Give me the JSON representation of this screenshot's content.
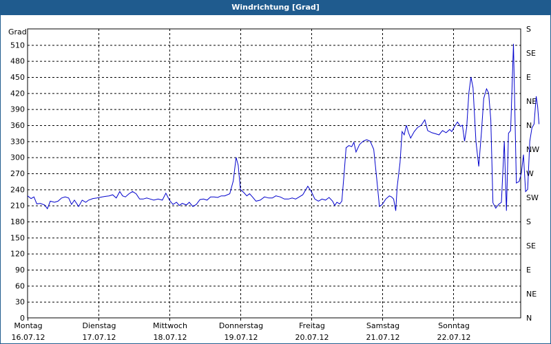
{
  "chart_data": {
    "type": "line",
    "title": "Windrichtung [Grad]",
    "ylabel": "Grad",
    "ylim": [
      0,
      540
    ],
    "y_ticks": [
      0,
      30,
      60,
      90,
      120,
      150,
      180,
      210,
      240,
      270,
      300,
      330,
      360,
      390,
      420,
      450,
      480,
      510
    ],
    "right_ticks": [
      {
        "value": 0,
        "label": "N"
      },
      {
        "value": 45,
        "label": "NE"
      },
      {
        "value": 90,
        "label": "E"
      },
      {
        "value": 135,
        "label": "SE"
      },
      {
        "value": 180,
        "label": "S"
      },
      {
        "value": 225,
        "label": "SW"
      },
      {
        "value": 270,
        "label": "W"
      },
      {
        "value": 315,
        "label": "NW"
      },
      {
        "value": 360,
        "label": "N"
      },
      {
        "value": 405,
        "label": "NE"
      },
      {
        "value": 450,
        "label": "E"
      },
      {
        "value": 495,
        "label": "SE"
      },
      {
        "value": 540,
        "label": "S"
      }
    ],
    "x_days": [
      {
        "day": "Montag",
        "date": "16.07.12"
      },
      {
        "day": "Dienstag",
        "date": "17.07.12"
      },
      {
        "day": "Mittwoch",
        "date": "18.07.12"
      },
      {
        "day": "Donnerstag",
        "date": "19.07.12"
      },
      {
        "day": "Freitag",
        "date": "20.07.12"
      },
      {
        "day": "Samstag",
        "date": "21.07.12"
      },
      {
        "day": "Sonntag",
        "date": "22.07.12"
      }
    ],
    "grid": true,
    "series": [
      {
        "color": "#0000cc",
        "points": [
          [
            0.0,
            228
          ],
          [
            0.05,
            223
          ],
          [
            0.09,
            226
          ],
          [
            0.13,
            213
          ],
          [
            0.18,
            214
          ],
          [
            0.24,
            211
          ],
          [
            0.28,
            204
          ],
          [
            0.32,
            218
          ],
          [
            0.38,
            216
          ],
          [
            0.43,
            218
          ],
          [
            0.48,
            224
          ],
          [
            0.53,
            226
          ],
          [
            0.58,
            224
          ],
          [
            0.62,
            212
          ],
          [
            0.66,
            220
          ],
          [
            0.72,
            208
          ],
          [
            0.77,
            220
          ],
          [
            0.82,
            216
          ],
          [
            0.86,
            220
          ],
          [
            0.92,
            223
          ],
          [
            0.98,
            224
          ],
          [
            1.05,
            226
          ],
          [
            1.1,
            227
          ],
          [
            1.15,
            228
          ],
          [
            1.2,
            230
          ],
          [
            1.25,
            224
          ],
          [
            1.3,
            236
          ],
          [
            1.34,
            228
          ],
          [
            1.38,
            226
          ],
          [
            1.43,
            232
          ],
          [
            1.48,
            236
          ],
          [
            1.53,
            232
          ],
          [
            1.58,
            222
          ],
          [
            1.63,
            222
          ],
          [
            1.68,
            224
          ],
          [
            1.73,
            222
          ],
          [
            1.78,
            220
          ],
          [
            1.84,
            222
          ],
          [
            1.9,
            220
          ],
          [
            1.95,
            233
          ],
          [
            2.0,
            220
          ],
          [
            2.05,
            212
          ],
          [
            2.1,
            216
          ],
          [
            2.14,
            210
          ],
          [
            2.18,
            214
          ],
          [
            2.24,
            211
          ],
          [
            2.28,
            216
          ],
          [
            2.33,
            208
          ],
          [
            2.38,
            212
          ],
          [
            2.43,
            221
          ],
          [
            2.48,
            222
          ],
          [
            2.53,
            220
          ],
          [
            2.58,
            226
          ],
          [
            2.63,
            226
          ],
          [
            2.68,
            225
          ],
          [
            2.73,
            228
          ],
          [
            2.78,
            228
          ],
          [
            2.85,
            232
          ],
          [
            2.9,
            256
          ],
          [
            2.94,
            300
          ],
          [
            2.97,
            285
          ],
          [
            3.0,
            240
          ],
          [
            3.05,
            234
          ],
          [
            3.09,
            228
          ],
          [
            3.13,
            232
          ],
          [
            3.17,
            226
          ],
          [
            3.22,
            218
          ],
          [
            3.28,
            220
          ],
          [
            3.34,
            226
          ],
          [
            3.4,
            224
          ],
          [
            3.45,
            224
          ],
          [
            3.5,
            228
          ],
          [
            3.56,
            226
          ],
          [
            3.62,
            222
          ],
          [
            3.68,
            222
          ],
          [
            3.73,
            224
          ],
          [
            3.78,
            222
          ],
          [
            3.83,
            226
          ],
          [
            3.88,
            230
          ],
          [
            3.95,
            246
          ],
          [
            4.0,
            236
          ],
          [
            4.05,
            222
          ],
          [
            4.1,
            218
          ],
          [
            4.15,
            222
          ],
          [
            4.2,
            220
          ],
          [
            4.25,
            225
          ],
          [
            4.3,
            218
          ],
          [
            4.33,
            210
          ],
          [
            4.36,
            216
          ],
          [
            4.4,
            213
          ],
          [
            4.43,
            218
          ],
          [
            4.46,
            266
          ],
          [
            4.49,
            318
          ],
          [
            4.53,
            322
          ],
          [
            4.57,
            320
          ],
          [
            4.6,
            328
          ],
          [
            4.63,
            310
          ],
          [
            4.68,
            324
          ],
          [
            4.73,
            330
          ],
          [
            4.78,
            333
          ],
          [
            4.83,
            330
          ],
          [
            4.88,
            315
          ],
          [
            4.92,
            262
          ],
          [
            4.96,
            208
          ],
          [
            5.0,
            212
          ],
          [
            5.05,
            222
          ],
          [
            5.1,
            228
          ],
          [
            5.13,
            226
          ],
          [
            5.16,
            222
          ],
          [
            5.19,
            200
          ],
          [
            5.21,
            244
          ],
          [
            5.25,
            290
          ],
          [
            5.28,
            348
          ],
          [
            5.31,
            342
          ],
          [
            5.34,
            360
          ],
          [
            5.37,
            346
          ],
          [
            5.4,
            336
          ],
          [
            5.45,
            348
          ],
          [
            5.5,
            356
          ],
          [
            5.55,
            360
          ],
          [
            5.6,
            370
          ],
          [
            5.64,
            350
          ],
          [
            5.7,
            346
          ],
          [
            5.75,
            344
          ],
          [
            5.8,
            342
          ],
          [
            5.85,
            350
          ],
          [
            5.9,
            346
          ],
          [
            5.95,
            352
          ],
          [
            5.98,
            348
          ],
          [
            6.02,
            358
          ],
          [
            6.06,
            366
          ],
          [
            6.1,
            358
          ],
          [
            6.13,
            360
          ],
          [
            6.16,
            330
          ],
          [
            6.19,
            356
          ],
          [
            6.22,
            420
          ],
          [
            6.25,
            450
          ],
          [
            6.28,
            430
          ],
          [
            6.32,
            330
          ],
          [
            6.36,
            283
          ],
          [
            6.4,
            350
          ],
          [
            6.43,
            410
          ],
          [
            6.47,
            428
          ],
          [
            6.5,
            420
          ],
          [
            6.53,
            370
          ],
          [
            6.56,
            215
          ],
          [
            6.6,
            205
          ],
          [
            6.64,
            212
          ],
          [
            6.68,
            216
          ],
          [
            6.72,
            330
          ],
          [
            6.75,
            200
          ],
          [
            6.78,
            345
          ],
          [
            6.81,
            350
          ],
          [
            6.85,
            512
          ],
          [
            6.89,
            252
          ],
          [
            6.93,
            255
          ],
          [
            6.96,
            270
          ],
          [
            6.99,
            305
          ],
          [
            7.02,
            236
          ],
          [
            7.05,
            240
          ],
          [
            7.08,
            330
          ],
          [
            7.11,
            355
          ],
          [
            7.14,
            362
          ],
          [
            7.17,
            414
          ],
          [
            7.19,
            395
          ],
          [
            7.21,
            362
          ]
        ]
      }
    ]
  }
}
